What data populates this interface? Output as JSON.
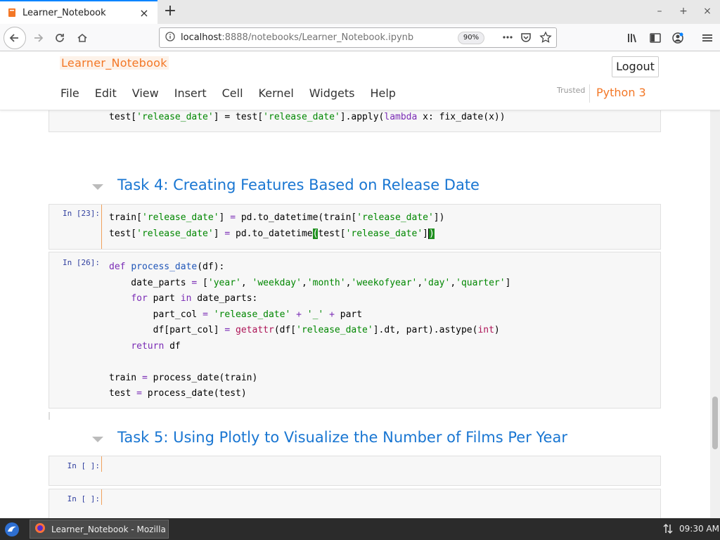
{
  "browser": {
    "tab_title": "Learner_Notebook",
    "url_host": "localhost",
    "url_rest": ":8888/notebooks/Learner_Notebook.ipynb",
    "zoom": "90%",
    "accent_color": "#0a84ff"
  },
  "jupyter": {
    "notebook_title": "Learner_Notebook",
    "logout_label": "Logout",
    "menu": [
      "File",
      "Edit",
      "View",
      "Insert",
      "Cell",
      "Kernel",
      "Widgets",
      "Help"
    ],
    "trusted_label": "Trusted",
    "kernel_name": "Python 3",
    "brand_color": "#f37726"
  },
  "cells": {
    "partial_cell": {
      "line1_a": "test[",
      "line1_s1": "'release_date'",
      "line1_b": "] = test[",
      "line1_s2": "'release_date'",
      "line1_c": "].apply(",
      "line1_kw": "lambda",
      "line1_d": " x: fix_date(x))"
    },
    "task4_heading": "Task 4: Creating Features Based on Release Date",
    "cell23": {
      "prompt": "In [23]:",
      "l1_a": "train[",
      "l1_s1": "'release_date'",
      "l1_b": "] ",
      "l1_op": "=",
      "l1_c": " pd.to_datetime(train[",
      "l1_s2": "'release_date'",
      "l1_d": "])",
      "l2_a": "test[",
      "l2_s1": "'release_date'",
      "l2_b": "] ",
      "l2_op": "=",
      "l2_c": " pd.to_datetime",
      "l2_brk1": "(",
      "l2_d": "test[",
      "l2_s2": "'release_date'",
      "l2_e": "]",
      "l2_brk2": ")"
    },
    "cell26": {
      "prompt": "In [26]:",
      "def": "def",
      "fname": "process_date",
      "fargs": "(df):",
      "l2_a": "    date_parts ",
      "l2_op": "=",
      "l2_b": " [",
      "s_year": "'year'",
      "s_weekday": "'weekday'",
      "s_month": "'month'",
      "s_weekofyear": "'weekofyear'",
      "s_day": "'day'",
      "s_quarter": "'quarter'",
      "comma_sp": ", ",
      "comma": ",",
      "close": "]",
      "for": "for",
      "for_mid": " part ",
      "in": "in",
      "for_end": " date_parts:",
      "l4_a": "        part_col ",
      "l4_op": "=",
      "l4_s1": "'release_date'",
      "l4_plus": "+",
      "l4_s2": "'_'",
      "l4_end": " part",
      "l5_a": "        df[part_col] ",
      "l5_op": "=",
      "l5_fn": "getattr",
      "l5_b": "(df[",
      "l5_s": "'release_date'",
      "l5_c": "].dt, part).astype(",
      "l5_int": "int",
      "l5_d": ")",
      "ret": "return",
      "ret_end": " df",
      "l8_a": "train ",
      "l8_op": "=",
      "l8_b": " process_date(train)",
      "l9_a": "test ",
      "l9_op": "=",
      "l9_b": " process_date(test)"
    },
    "task5_heading": "Task 5: Using Plotly to Visualize the Number of Films Per Year",
    "empty_prompt_1": "In [ ]:",
    "empty_prompt_2": "In [ ]:"
  },
  "taskbar": {
    "window_label": "Learner_Notebook - Mozilla ...",
    "clock": "09:30 AM"
  }
}
